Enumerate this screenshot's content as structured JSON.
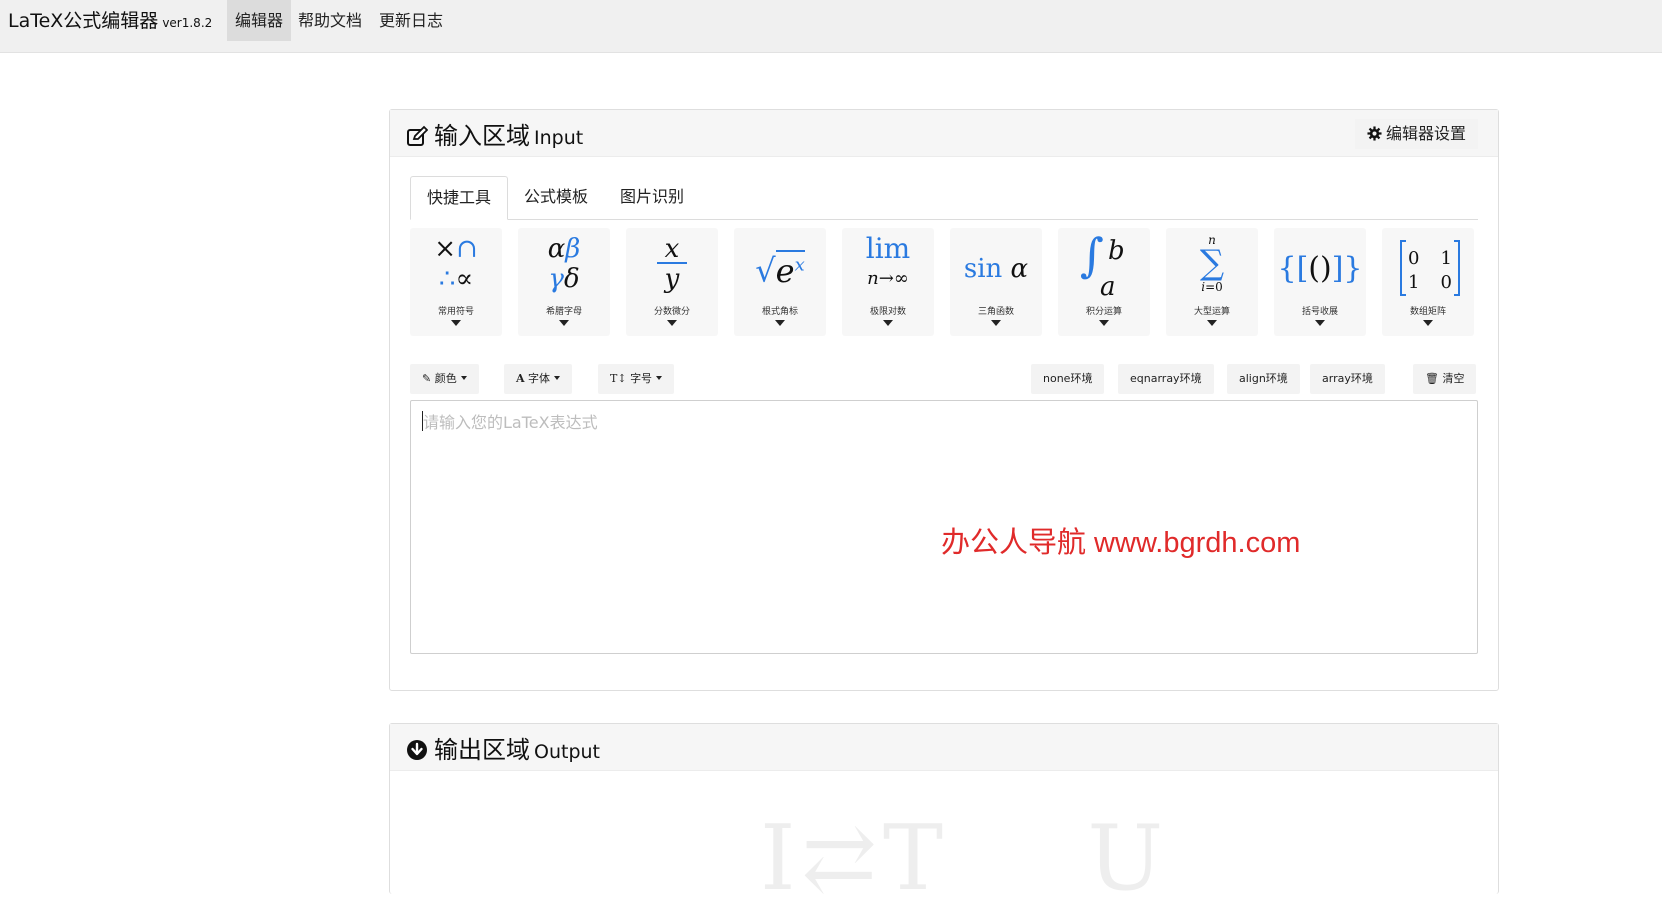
{
  "app": {
    "brand": "LaTeX公式编辑器",
    "version": "ver1.8.2",
    "nav": [
      {
        "label": "编辑器",
        "active": true
      },
      {
        "label": "帮助文档",
        "active": false
      },
      {
        "label": "更新日志",
        "active": false
      }
    ]
  },
  "input_panel": {
    "title": "输入区域",
    "title_en": "Input",
    "settings_label": "编辑器设置",
    "tabs": [
      {
        "label": "快捷工具",
        "active": true
      },
      {
        "label": "公式模板",
        "active": false
      },
      {
        "label": "图片识别",
        "active": false
      }
    ],
    "tools": [
      {
        "label": "常用符号"
      },
      {
        "label": "希腊字母"
      },
      {
        "label": "分数微分"
      },
      {
        "label": "根式角标"
      },
      {
        "label": "极限对数"
      },
      {
        "label": "三角函数"
      },
      {
        "label": "积分运算"
      },
      {
        "label": "大型运算"
      },
      {
        "label": "括号收展"
      },
      {
        "label": "数组矩阵"
      }
    ],
    "toolbar": {
      "color": "颜色",
      "font": "字体",
      "size": "字号",
      "env_none": "none环境",
      "env_eqnarray": "eqnarray环境",
      "env_align": "align环境",
      "env_array": "array环境",
      "clear": "清空"
    },
    "editor_placeholder": "请输入您的LaTeX表达式",
    "watermark": "办公人导航 www.bgrdh.com"
  },
  "output_panel": {
    "title": "输出区域",
    "title_en": "Output"
  },
  "colors": {
    "accent_blue": "#2a7ae0",
    "watermark_red": "#e02a2a",
    "navbar_bg": "#f0f0f0"
  }
}
